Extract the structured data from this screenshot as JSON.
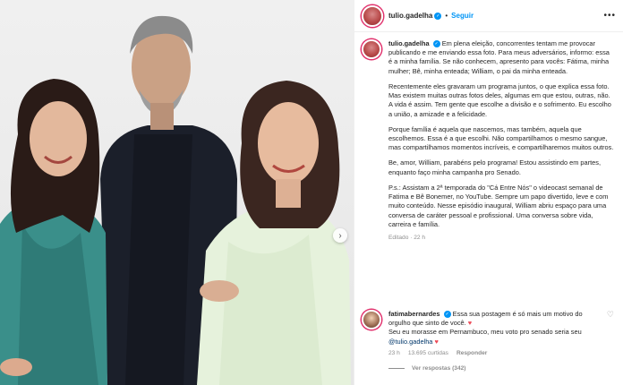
{
  "header": {
    "username": "tulio.gadelha",
    "separator": "•",
    "follow_label": "Seguir",
    "more_icon": "more-horizontal-icon"
  },
  "caption": {
    "username": "tulio.gadelha",
    "paragraphs": [
      "Em plena eleição, concorrentes tentam me provocar publicando e me enviando essa foto. Para meus adversários, informo: essa é a minha família. Se não conhecem, apresento para vocês: Fátima, minha mulher; Bê, minha enteada; William, o pai da minha enteada.",
      "Recentemente eles gravaram um programa juntos, o que explica essa foto. Mas existem muitas outras fotos deles, algumas em que estou, outras, não. A vida é assim. Tem gente que escolhe a divisão e o sofrimento. Eu escolho a união, a amizade e a felicidade.",
      "Porque família é aquela que nascemos, mas também, aquela que escolhemos. Essa é a que escolhi. Não compartilhamos o mesmo sangue, mas compartilhamos momentos incríveis, e compartilharemos muitos outros.",
      "Be, amor, William, parabéns pelo programa! Estou assistindo em partes, enquanto faço minha campanha pro Senado.",
      "P.s.: Assistam a 2ª temporada do \"Cá Entre Nós\" o videocast semanal de Fatima e Bê Bonemer, no YouTube. Sempre um papo divertido, leve e com muito conteúdo. Nesse episódio inaugural, William abriu espaço para uma conversa de caráter pessoal e profissional. Uma conversa sobre vida, carreira e família."
    ],
    "edited": "Editado",
    "time": "22 h"
  },
  "reply": {
    "username": "fatimabernardes",
    "text_1": "Essa sua postagem é só mais um motivo do orgulho que sinto de você.",
    "heart_1": "♥",
    "text_2": "Seu eu morasse em Pernambuco, meu voto pro senado seria seu",
    "mention": "@tulio.gadelha",
    "heart_2": "♥",
    "time": "23 h",
    "likes": "13.695 curtidas",
    "reply_label": "Responder",
    "see_replies": "Ver respostas (342)",
    "like_icon": "heart-outline-icon"
  },
  "photo": {
    "nav_icon": "chevron-right-icon"
  }
}
